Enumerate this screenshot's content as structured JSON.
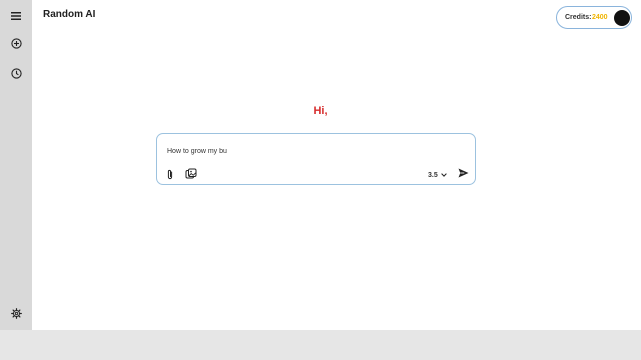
{
  "app": {
    "title": "Random AI"
  },
  "sidebar": {
    "items": [
      {
        "icon": "hamburger-menu-icon"
      },
      {
        "icon": "new-chat-plus-icon"
      },
      {
        "icon": "history-clock-icon"
      },
      {
        "icon": "settings-gear-icon"
      }
    ]
  },
  "credits": {
    "label": "Credits:",
    "value": "2400",
    "value_color": "#f0b400"
  },
  "greeting": {
    "text": "Hi,",
    "color": "#d62b2b"
  },
  "composer": {
    "input_value": "How to grow my bu",
    "attach_icon": "paperclip-icon",
    "tools_icon": "image-gallery-icon",
    "model_version": "3.5",
    "send_icon": "send-arrow-icon"
  }
}
